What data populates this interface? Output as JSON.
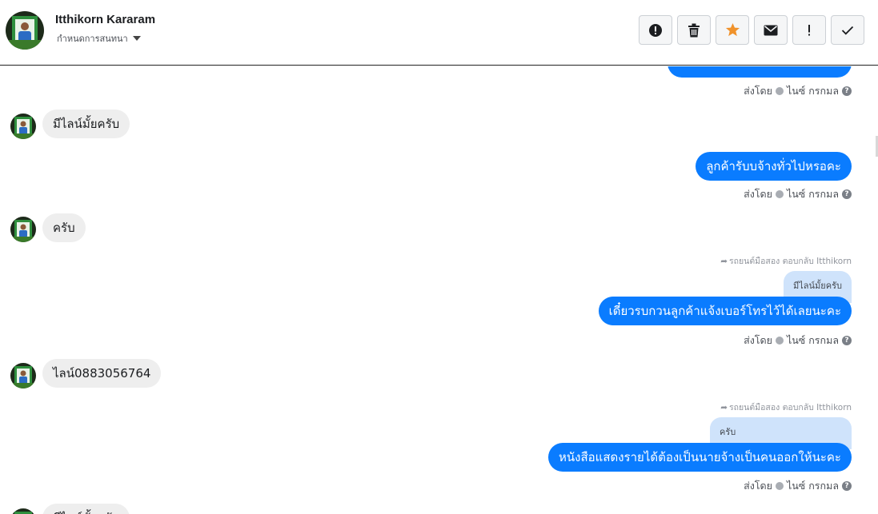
{
  "header": {
    "contact_name": "Itthikorn Kararam",
    "assign_label": "กำหนดการสนทนา"
  },
  "actions": [
    {
      "name": "report-spam-button",
      "icon": "exclamation-circle-icon"
    },
    {
      "name": "delete-button",
      "icon": "trash-icon"
    },
    {
      "name": "star-button",
      "icon": "star-icon"
    },
    {
      "name": "mark-unread-button",
      "icon": "envelope-icon"
    },
    {
      "name": "follow-up-button",
      "icon": "exclamation-icon"
    },
    {
      "name": "mark-done-button",
      "icon": "checkmark-icon"
    }
  ],
  "colors": {
    "outgoing_bubble": "#0a7cff",
    "incoming_bubble": "#eeeeee",
    "quote_bubble": "#cfe3fb",
    "star": "#f0922b"
  },
  "messages": {
    "m1": {
      "text": "มีไลน์มั้ยครับ"
    },
    "m2": {
      "text": "ลูกค้ารับบจ้างทั่วไปหรอคะ"
    },
    "m3": {
      "text": "ครับ"
    },
    "m4": {
      "reply_context": "รถยนต์มือสอง ตอบกลับ Itthikorn",
      "quoted": "มีไลน์มั้ยครับ",
      "text": "เดี๋ยวรบกวนลูกค้าแจ้งเบอร์โทรไว้ได้เลยนะคะ"
    },
    "m5": {
      "text": "ไลน์0883056764"
    },
    "m6": {
      "reply_context": "รถยนต์มือสอง ตอบกลับ Itthikorn",
      "quoted": "ครับ",
      "text": "หนังสือแสดงรายได้ต้องเป็นนายจ้างเป็นคนออกให้นะคะ"
    },
    "m7": {
      "text": "มีไลน์มั้ยครับ"
    }
  },
  "sent_by": {
    "label": "ส่งโดย",
    "agent": "ไนซ์ กรกมล"
  }
}
